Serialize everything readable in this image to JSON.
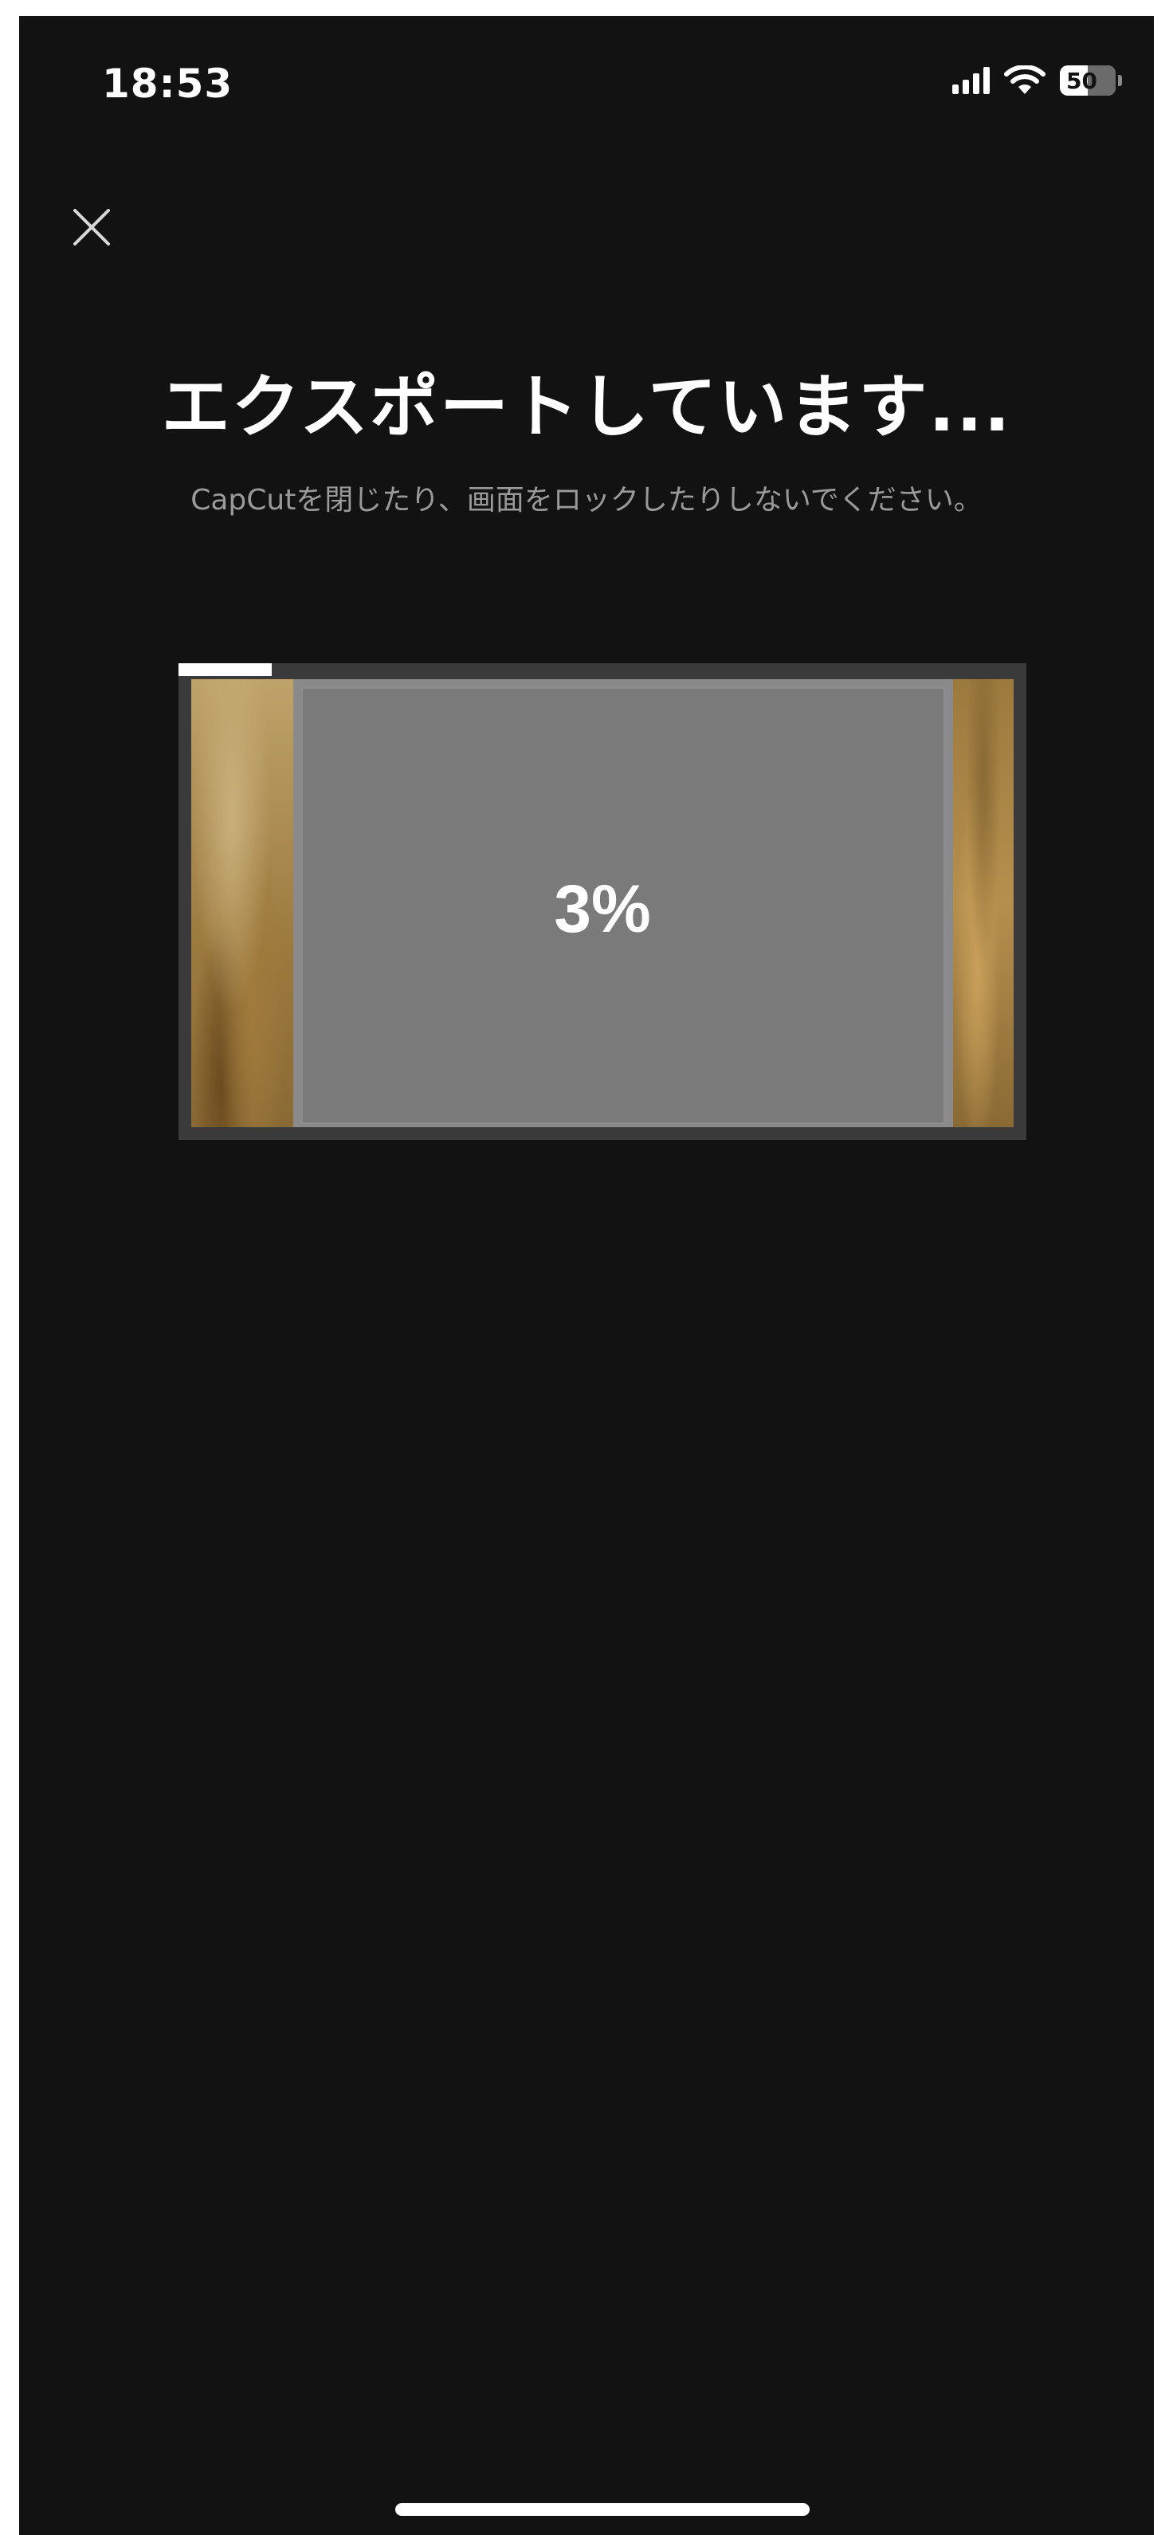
{
  "status_bar": {
    "time": "18:53",
    "battery_level": "50",
    "battery_fraction": 0.5
  },
  "close": {
    "icon": "close-icon"
  },
  "export": {
    "title": "エクスポートしています...",
    "subtitle": "CapCutを閉じたり、画面をロックしたりしないでください。",
    "progress_text": "3%",
    "progress_fraction": 0.11
  },
  "colors": {
    "background": "#121212",
    "text": "#ffffff",
    "subtitle": "#9a9a9a",
    "progress": "#ffffff"
  }
}
